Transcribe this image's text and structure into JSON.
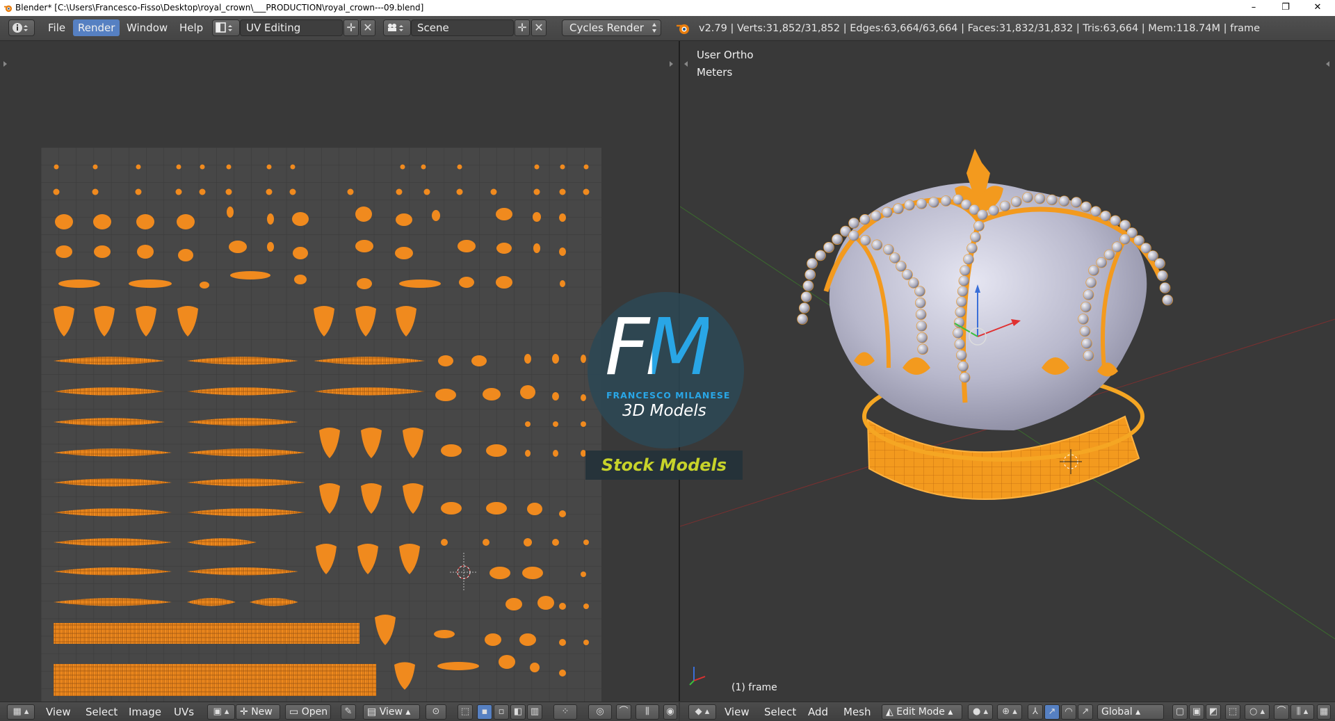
{
  "window": {
    "title": "Blender* [C:\\Users\\Francesco-Fisso\\Desktop\\royal_crown\\___PRODUCTION\\royal_crown---09.blend]",
    "minimize": "–",
    "maximize": "❐",
    "close": "✕"
  },
  "info_header": {
    "menus": [
      "File",
      "Render",
      "Window",
      "Help"
    ],
    "active_menu": "Render",
    "screen_layout": "UV Editing",
    "scene": "Scene",
    "render_engine": "Cycles Render",
    "stats": "v2.79 | Verts:31,852/31,852 | Edges:63,664/63,664 | Faces:31,832/31,832 | Tris:63,664 | Mem:118.74M | frame"
  },
  "viewport": {
    "view_name": "User Ortho",
    "units": "Meters",
    "frame_label": "(1) frame"
  },
  "uv_footer": {
    "menus": [
      "View",
      "Select",
      "Image",
      "UVs"
    ],
    "new_label": "New",
    "open_label": "Open",
    "view_label": "View"
  },
  "view3d_footer": {
    "menus": [
      "View",
      "Select",
      "Add",
      "Mesh"
    ],
    "mode": "Edit Mode",
    "orientation": "Global"
  },
  "watermark": {
    "logo_letters": "FM",
    "name": "FRANCESCO MILANESE",
    "tagline": "3D Models",
    "banner": "Stock Models"
  },
  "colors": {
    "accent": "#5680c2",
    "uv_island": "#f08a1e",
    "wire": "#f5a623",
    "logo_f": "#ffffff",
    "logo_m": "#29a6e6",
    "stock_text": "#c7d32a"
  }
}
